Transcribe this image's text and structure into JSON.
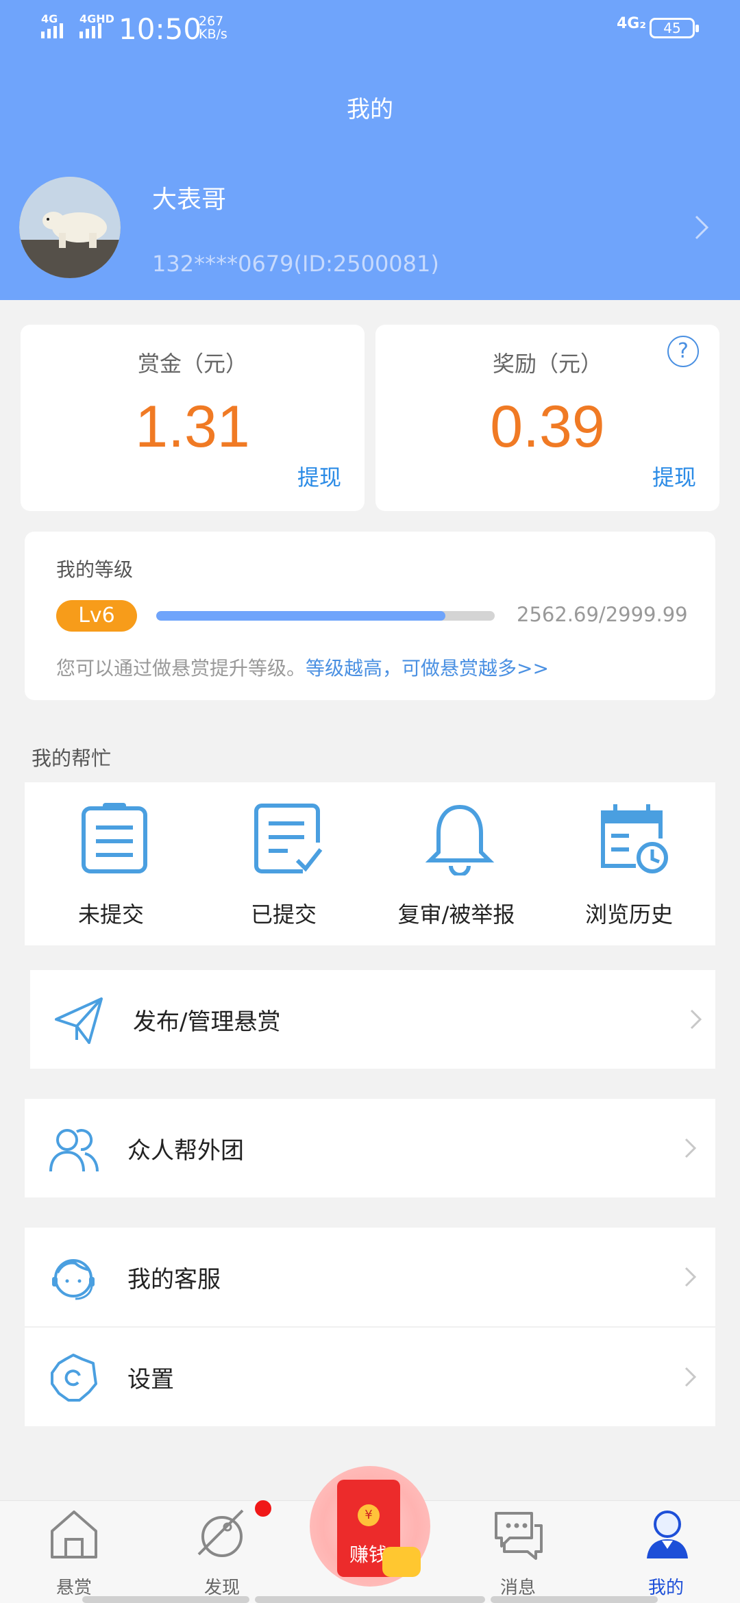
{
  "status_bar": {
    "network1": "4G",
    "network2": "4GHD",
    "time": "10:50",
    "speed_value": "267",
    "speed_unit": "KB/s",
    "network3": "4G₂",
    "battery": "45"
  },
  "header": {
    "title": "我的",
    "username": "大表哥",
    "user_id": "132****0679(ID:2500081)"
  },
  "balances": {
    "bounty_label": "赏金（元）",
    "bounty_value": "1.31",
    "bounty_withdraw": "提现",
    "reward_label": "奖励（元）",
    "reward_value": "0.39",
    "reward_withdraw": "提现",
    "help_icon": "?"
  },
  "level": {
    "title": "我的等级",
    "badge": "Lv6",
    "progress_text": "2562.69/2999.99",
    "progress_fraction": 0.854,
    "hint": "您可以通过做悬赏提升等级。",
    "hint_link": "等级越高，可做悬赏越多>>"
  },
  "help_section": {
    "title": "我的帮忙",
    "items": [
      {
        "label": "未提交",
        "icon": "clipboard-icon"
      },
      {
        "label": "已提交",
        "icon": "submitted-doc-icon"
      },
      {
        "label": "复审/被举报",
        "icon": "bell-icon"
      },
      {
        "label": "浏览历史",
        "icon": "calendar-clock-icon"
      }
    ]
  },
  "menu": {
    "publish": "发布/管理悬赏",
    "team": "众人帮外团",
    "service": "我的客服",
    "settings": "设置"
  },
  "tabbar": {
    "tabs": [
      {
        "label": "悬赏",
        "icon": "home-icon"
      },
      {
        "label": "发现",
        "icon": "discover-planet-icon"
      },
      {
        "label": "消息",
        "icon": "chat-bubbles-icon"
      },
      {
        "label": "我的",
        "icon": "profile-icon"
      }
    ],
    "earn_label": "赚钱",
    "earn_coin": "¥",
    "active_color": "#1d4fd8"
  },
  "colors": {
    "header_bg": "#6fa4fb",
    "amount": "#f07a24",
    "link": "#2b8be6",
    "level_badge": "#f79c1a"
  }
}
